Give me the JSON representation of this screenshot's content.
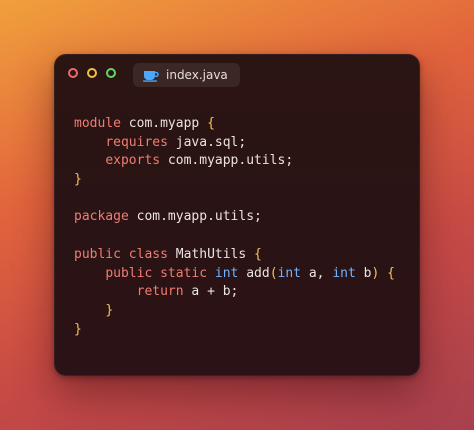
{
  "tab": {
    "filename": "index.java",
    "icon": "coffee-cup-icon"
  },
  "window_controls": [
    "close",
    "minimize",
    "maximize"
  ],
  "colors": {
    "keyword": "#f07c72",
    "type": "#6fb3ff",
    "brace": "#f2c55c",
    "text": "#ece3de",
    "close": "#ef6b6b",
    "minimize": "#efc047",
    "maximize": "#5fd76a",
    "tab_icon": "#4aa8ff"
  },
  "code_lines": [
    [
      {
        "t": "module",
        "c": "kw"
      },
      {
        "t": " com.myapp ",
        "c": "tx"
      },
      {
        "t": "{",
        "c": "br"
      }
    ],
    [
      {
        "t": "    ",
        "c": "tx"
      },
      {
        "t": "requires",
        "c": "kw"
      },
      {
        "t": " java.sql;",
        "c": "tx"
      }
    ],
    [
      {
        "t": "    ",
        "c": "tx"
      },
      {
        "t": "exports",
        "c": "kw"
      },
      {
        "t": " com.myapp.utils;",
        "c": "tx"
      }
    ],
    [
      {
        "t": "}",
        "c": "br"
      }
    ],
    [],
    [
      {
        "t": "package",
        "c": "kw"
      },
      {
        "t": " com.myapp.utils;",
        "c": "tx"
      }
    ],
    [],
    [
      {
        "t": "public",
        "c": "kw"
      },
      {
        "t": " ",
        "c": "tx"
      },
      {
        "t": "class",
        "c": "kw"
      },
      {
        "t": " MathUtils ",
        "c": "tx"
      },
      {
        "t": "{",
        "c": "br"
      }
    ],
    [
      {
        "t": "    ",
        "c": "tx"
      },
      {
        "t": "public",
        "c": "kw"
      },
      {
        "t": " ",
        "c": "tx"
      },
      {
        "t": "static",
        "c": "kw"
      },
      {
        "t": " ",
        "c": "tx"
      },
      {
        "t": "int",
        "c": "ty"
      },
      {
        "t": " add",
        "c": "tx"
      },
      {
        "t": "(",
        "c": "br"
      },
      {
        "t": "int",
        "c": "ty"
      },
      {
        "t": " a, ",
        "c": "tx"
      },
      {
        "t": "int",
        "c": "ty"
      },
      {
        "t": " b",
        "c": "tx"
      },
      {
        "t": ")",
        "c": "br"
      },
      {
        "t": " ",
        "c": "tx"
      },
      {
        "t": "{",
        "c": "br"
      }
    ],
    [
      {
        "t": "        ",
        "c": "tx"
      },
      {
        "t": "return",
        "c": "kw"
      },
      {
        "t": " a + b;",
        "c": "tx"
      }
    ],
    [
      {
        "t": "    ",
        "c": "tx"
      },
      {
        "t": "}",
        "c": "br"
      }
    ],
    [
      {
        "t": "}",
        "c": "br"
      }
    ]
  ]
}
